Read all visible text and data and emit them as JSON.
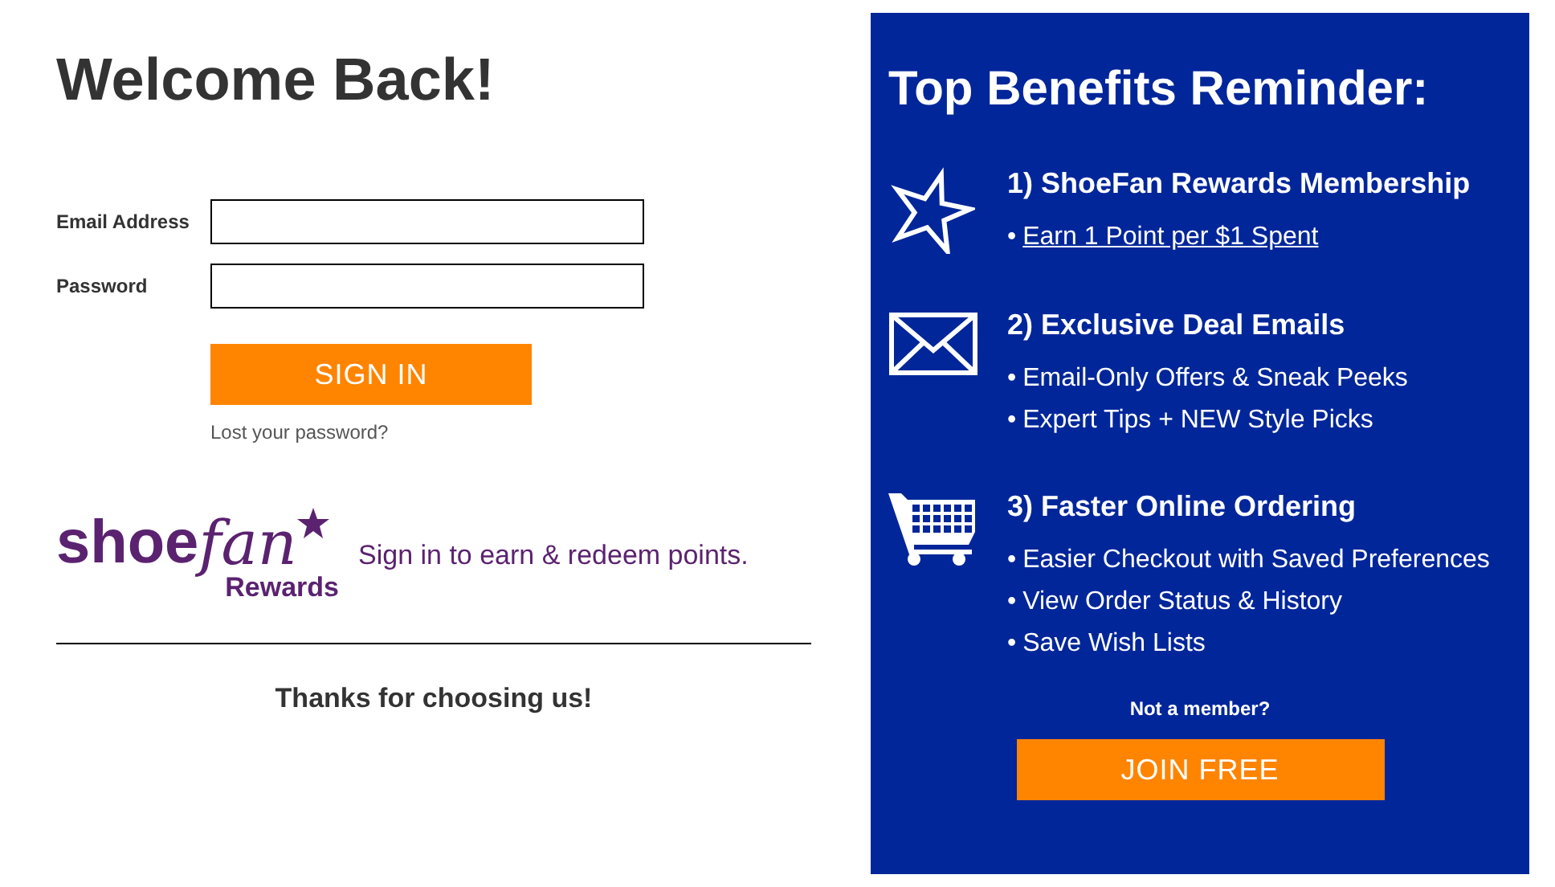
{
  "login": {
    "title": "Welcome Back!",
    "fields": [
      {
        "label": "Email Address"
      },
      {
        "label": "Password"
      }
    ],
    "submit": "SIGN IN",
    "forgot_link": "Lost your password?"
  },
  "rewards": {
    "logo": {
      "word": "shoe",
      "script": "fan",
      "sub": "Rewards"
    },
    "tagline": "Sign in to earn & redeem points."
  },
  "thanks": "Thanks for choosing us!",
  "benefits": {
    "title": "Top Benefits Reminder:",
    "sections": [
      {
        "heading": "1) ShoeFan Rewards Membership",
        "items": [
          {
            "bullet": "•",
            "text": "Earn 1 Point per $1 Spent",
            "kind": "link"
          }
        ]
      },
      {
        "heading": "2) Exclusive Deal Emails",
        "items": [
          {
            "bullet": "•",
            "text": "Email-Only Offers & Sneak Peeks",
            "kind": "plain"
          },
          {
            "bullet": "•",
            "text": "Expert Tips + NEW Style Picks",
            "kind": "plain"
          }
        ]
      },
      {
        "heading": "3) Faster Online Ordering",
        "items": [
          {
            "bullet": "•",
            "text": "Easier Checkout with Saved Preferences",
            "kind": "plain"
          },
          {
            "bullet": "•",
            "text": "View Order Status & History",
            "kind": "plain"
          },
          {
            "bullet": "•",
            "text": "Save Wish Lists",
            "kind": "plain"
          }
        ]
      }
    ],
    "prompt": "Not a member?",
    "join": "JOIN FREE"
  }
}
